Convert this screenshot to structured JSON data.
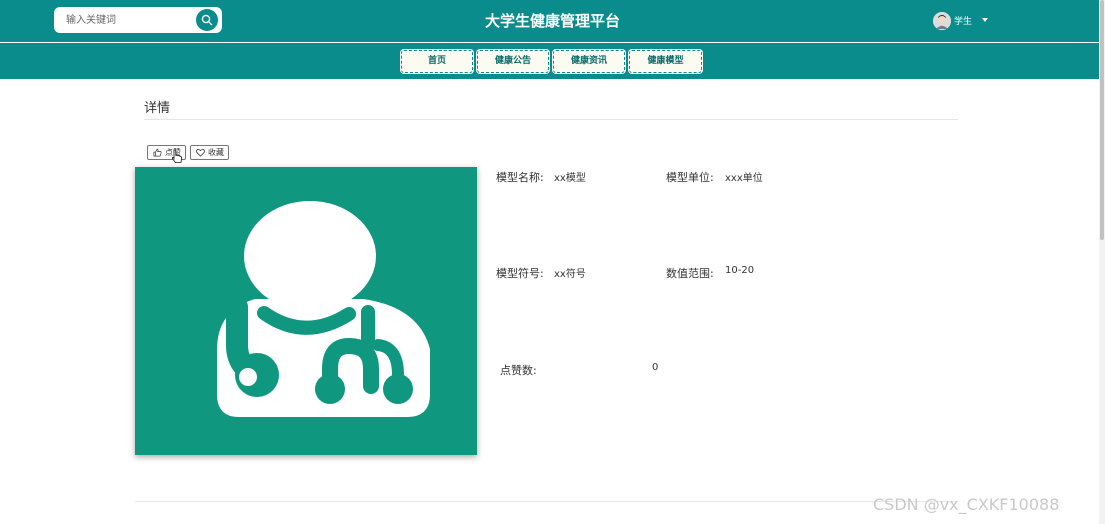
{
  "header": {
    "title": "大学生健康管理平台",
    "search": {
      "placeholder": "输入关键词",
      "value": ""
    },
    "user": {
      "name": "学生"
    }
  },
  "nav": [
    {
      "label": "首页"
    },
    {
      "label": "健康公告"
    },
    {
      "label": "健康资讯"
    },
    {
      "label": "健康模型"
    }
  ],
  "detail": {
    "section_title": "详情",
    "like_label": "点赞",
    "favorite_label": "收藏",
    "fields": {
      "model_name": {
        "label": "模型名称:",
        "value": "xx模型"
      },
      "model_unit": {
        "label": "模型单位:",
        "value": "xxx单位"
      },
      "model_symbol": {
        "label": "模型符号:",
        "value": "xx符号"
      },
      "value_range": {
        "label": "数值范围:",
        "value": "10-20"
      },
      "like_count": {
        "label": "点赞数:",
        "value": "0"
      }
    }
  },
  "watermark": "CSDN @vx_CXKF10088",
  "colors": {
    "brand": "#0b8c8c",
    "cover": "#10977f",
    "nav_bg": "#fbfbf1"
  },
  "icons": {
    "search": "search-icon",
    "like": "thumbs-up-icon",
    "favorite": "heart-icon",
    "cover": "doctor-stethoscope-icon"
  }
}
